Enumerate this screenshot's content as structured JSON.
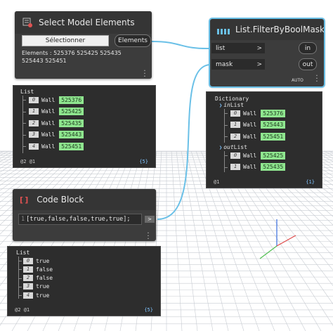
{
  "canvas": {
    "grid_color": "#c8ccd2",
    "wire_color": "#6ac0e7"
  },
  "select_node": {
    "title": "Select Model Elements",
    "icon": "select-elements-icon",
    "button_label": "Sélectionner",
    "output_port": "Elements",
    "summary_line1": "Elements : 525376 525425 525435",
    "summary_line2": "525443 525451"
  },
  "select_preview": {
    "header": "List",
    "items": [
      {
        "index": "0",
        "type": "Wall",
        "value": "525376"
      },
      {
        "index": "1",
        "type": "Wall",
        "value": "525425"
      },
      {
        "index": "2",
        "type": "Wall",
        "value": "525435"
      },
      {
        "index": "3",
        "type": "Wall",
        "value": "525443"
      },
      {
        "index": "4",
        "type": "Wall",
        "value": "525451"
      }
    ],
    "levels": "@2 @1",
    "count": "{5}"
  },
  "filter_node": {
    "title": "List.FilterByBoolMask",
    "icon": "list-icon",
    "inputs": [
      "list",
      "mask"
    ],
    "outputs": [
      "in",
      "out"
    ],
    "lacing": "AUTO"
  },
  "filter_preview": {
    "header": "Dictionary",
    "in_label": "in",
    "in_suffix": "List",
    "out_label": "out",
    "out_suffix": "List",
    "in_items": [
      {
        "index": "0",
        "type": "Wall",
        "value": "525376"
      },
      {
        "index": "1",
        "type": "Wall",
        "value": "525443"
      },
      {
        "index": "2",
        "type": "Wall",
        "value": "525451"
      }
    ],
    "out_items": [
      {
        "index": "0",
        "type": "Wall",
        "value": "525425"
      },
      {
        "index": "1",
        "type": "Wall",
        "value": "525435"
      }
    ],
    "levels": "@1",
    "count": "{1}"
  },
  "code_node": {
    "title": "Code Block",
    "icon": "code-block-icon",
    "line_number": "1",
    "code": "[true,false,false,true,true];",
    "output_port": ">"
  },
  "code_preview": {
    "header": "List",
    "items": [
      {
        "index": "0",
        "value": "true"
      },
      {
        "index": "1",
        "value": "false"
      },
      {
        "index": "2",
        "value": "false"
      },
      {
        "index": "3",
        "value": "true"
      },
      {
        "index": "4",
        "value": "true"
      }
    ],
    "levels": "@2 @1",
    "count": "{5}"
  }
}
